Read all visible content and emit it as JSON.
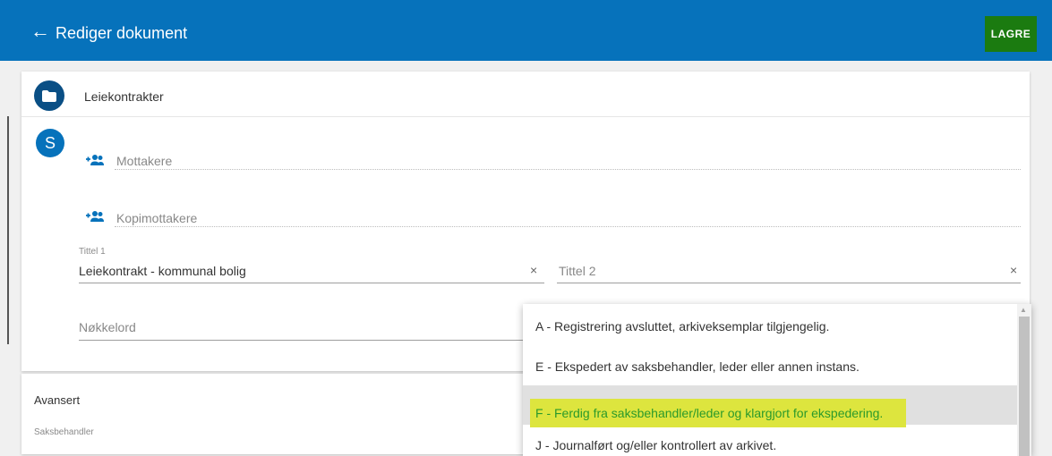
{
  "header": {
    "title": "Rediger dokument",
    "save_label": "LAGRE",
    "colors": {
      "bar": "#0672bb",
      "save": "#1b7b10"
    }
  },
  "folder": {
    "label": "Leiekontrakter",
    "icon": "folder-icon"
  },
  "avatar": {
    "letter": "S"
  },
  "fields": {
    "mottakere_placeholder": "Mottakere",
    "kopimottakere_placeholder": "Kopimottakere",
    "tittel1_label": "Tittel 1",
    "tittel1_value": "Leiekontrakt - kommunal bolig",
    "tittel2_placeholder": "Tittel 2",
    "nokkelord_placeholder": "Nøkkelord",
    "clear_symbol": "×"
  },
  "advanced": {
    "title": "Avansert",
    "saksbehandler_label": "Saksbehandler"
  },
  "dropdown": {
    "options": [
      "A - Registrering avsluttet, arkiveksemplar tilgjengelig.",
      "E - Ekspedert av saksbehandler, leder eller annen instans.",
      "F - Ferdig fra saksbehandler/leder og klargjort for ekspedering.",
      "J - Journalført og/eller kontrollert av arkivet."
    ],
    "selected_index": 2,
    "highlight_color": "#dde53e"
  }
}
